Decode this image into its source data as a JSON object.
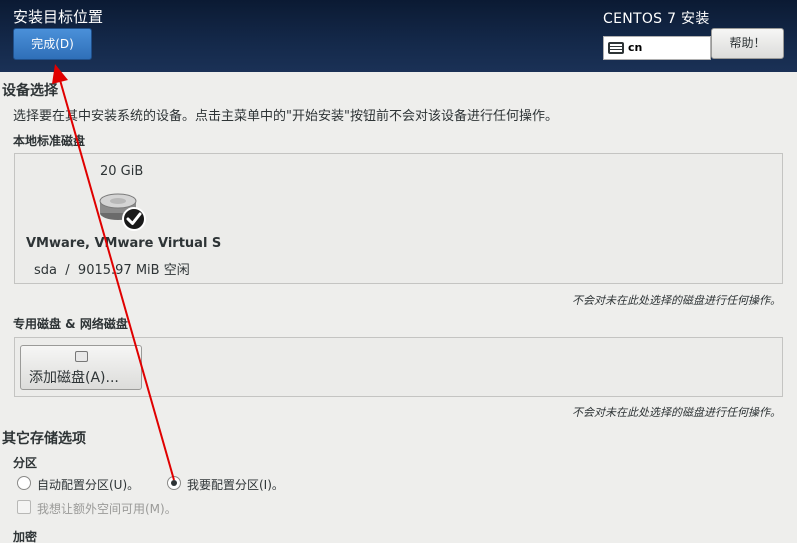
{
  "header": {
    "title": "安装目标位置",
    "done_label": "完成(D)",
    "product": "CENTOS 7 安装",
    "keyboard_layout": "cn",
    "help_label": "帮助！"
  },
  "device_selection": {
    "title": "设备选择",
    "description": "选择要在其中安装系统的设备。点击主菜单中的\"开始安装\"按钮前不会对该设备进行任何操作。",
    "local_disks_label": "本地标准磁盘",
    "disk": {
      "size": "20 GiB",
      "name": "VMware, VMware Virtual S",
      "device": "sda",
      "separator": "/",
      "free": "9015.97 MiB 空闲"
    },
    "local_note": "不会对未在此处选择的磁盘进行任何操作。",
    "special_label": "专用磁盘 & 网络磁盘",
    "add_disk_label": "添加磁盘(A)...",
    "special_note": "不会对未在此处选择的磁盘进行任何操作。"
  },
  "other_storage": {
    "title": "其它存储选项",
    "partition_label": "分区",
    "auto_partition": "自动配置分区(U)。",
    "manual_partition": "我要配置分区(I)。",
    "extra_space": "我想让额外空间可用(M)。",
    "encryption_label": "加密"
  },
  "colors": {
    "header_bg": "#14294a",
    "accent_blue": "#2f6fb8",
    "annotation_red": "#e00000"
  }
}
